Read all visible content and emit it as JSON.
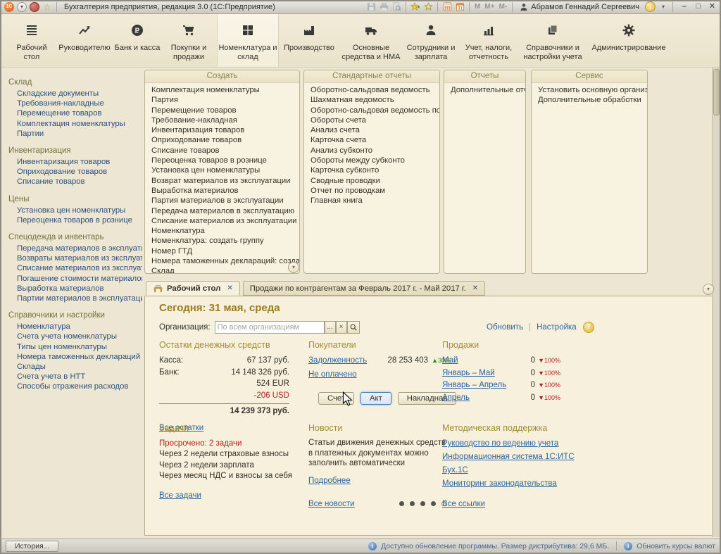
{
  "icons": {
    "chevron_down": "▾",
    "close": "✕",
    "clear": "×",
    "ellipsis": "...",
    "minimize": "–",
    "maximize": "□",
    "question": "?",
    "info": "i",
    "star": "☆",
    "logo": "1С"
  },
  "titlebar": {
    "title": "Бухгалтерия предприятия, редакция 3.0  (1С:Предприятие)",
    "user": "Абрамов Геннадий Сергеевич",
    "memory": [
      "M",
      "M+",
      "M-"
    ]
  },
  "ribbon": {
    "sections": [
      {
        "label": "Рабочий стол"
      },
      {
        "label": "Руководителю"
      },
      {
        "label": "Банк и касса"
      },
      {
        "label": "Покупки и продажи"
      },
      {
        "label": "Номенклатура и склад"
      },
      {
        "label": "Производство"
      },
      {
        "label": "Основные средства и НМА"
      },
      {
        "label": "Сотрудники и зарплата"
      },
      {
        "label": "Учет, налоги, отчетность"
      },
      {
        "label": "Справочники и настройки учета"
      },
      {
        "label": "Администрирование"
      }
    ]
  },
  "sidebar": {
    "groups": [
      {
        "title": "Склад",
        "items": [
          "Складские документы",
          "Требования-накладные",
          "Перемещение товаров",
          "Комплектация номенклатуры",
          "Партии"
        ]
      },
      {
        "title": "Инвентаризация",
        "items": [
          "Инвентаризация товаров",
          "Оприходование товаров",
          "Списание товаров"
        ]
      },
      {
        "title": "Цены",
        "items": [
          "Установка цен номенклатуры",
          "Переоценка товаров в рознице"
        ]
      },
      {
        "title": "Спецодежда и инвентарь",
        "items": [
          "Передача материалов в эксплуатацию",
          "Возвраты материалов из эксплуатации",
          "Списание материалов из эксплуатации",
          "Погашение стоимости материалов",
          "Выработка материалов",
          "Партии материалов в эксплуатации"
        ]
      },
      {
        "title": "Справочники и настройки",
        "items": [
          "Номенклатура",
          "Счета учета номенклатуры",
          "Типы цен номенклатуры",
          "Номера таможенных деклараций",
          "Склады",
          "Счета учета в НТТ",
          "Способы отражения расходов"
        ]
      }
    ]
  },
  "panels": {
    "create": {
      "title": "Создать",
      "items": [
        "Комплектация номенклатуры",
        "Партия",
        "Перемещение товаров",
        "Требование-накладная",
        "Инвентаризация товаров",
        "Оприходование товаров",
        "Списание товаров",
        "Переоценка товаров в рознице",
        "Установка цен номенклатуры",
        "Возврат материалов из эксплуатации",
        "Выработка материалов",
        "Партия материалов в эксплуатации",
        "Передача материалов в эксплуатацию",
        "Списание материалов из эксплуатации",
        "Номенклатура",
        "Номенклатура: создать группу",
        "Номер ГТД",
        "Номера таможенных деклараций: создать группу",
        "Склад"
      ]
    },
    "standard": {
      "title": "Стандартные отчеты",
      "items": [
        "Оборотно-сальдовая ведомость",
        "Шахматная ведомость",
        "Оборотно-сальдовая ведомость по счету",
        "Обороты счета",
        "Анализ счета",
        "Карточка счета",
        "Анализ субконто",
        "Обороты между субконто",
        "Карточка субконто",
        "Сводные проводки",
        "Отчет по проводкам",
        "Главная книга"
      ]
    },
    "reports": {
      "title": "Отчеты",
      "items": [
        "Дополнительные отчеты"
      ]
    },
    "service": {
      "title": "Сервис",
      "items": [
        "Установить основную организацию",
        "Дополнительные обработки"
      ]
    }
  },
  "tabs": {
    "desktop": "Рабочий стол",
    "sales": "Продажи по контрагентам за Февраль 2017 г. - Май 2017 г."
  },
  "desktop": {
    "today": "Сегодня: 31 мая, среда",
    "organization": {
      "label": "Организация:",
      "placeholder": "По всем организациям"
    },
    "refresh": "Обновить",
    "settings": "Настройка",
    "cash": {
      "title": "Остатки денежных средств",
      "rows": [
        {
          "label": "Касса:",
          "value": "67 137 руб."
        },
        {
          "label": "Банк:",
          "value": "14 148 326 руб."
        },
        {
          "label": "",
          "value": "524 EUR"
        },
        {
          "label": "",
          "value": "-206 USD",
          "negative": true
        }
      ],
      "total": "14 239 373 руб.",
      "link": "Все остатки"
    },
    "buyers": {
      "title": "Покупатели",
      "debt_link": "Задолженность",
      "debt_value": "28 253 403",
      "debt_change": "▲30%",
      "unpaid_link": "Не оплачено",
      "buttons": [
        "Счет",
        "Акт",
        "Накладная"
      ]
    },
    "sales": {
      "title": "Продажи",
      "rows": [
        {
          "label": "Май",
          "value": "0",
          "change": "▼100%"
        },
        {
          "label": "Январь – Май",
          "value": "0",
          "change": "▼100%"
        },
        {
          "label": "Январь – Апрель",
          "value": "0",
          "change": "▼100%"
        },
        {
          "label": "Апрель",
          "value": "0",
          "change": "▼100%"
        }
      ]
    },
    "tasks": {
      "title": "Задачи",
      "overdue": "Просрочено: 2 задачи",
      "items": [
        "Через 2 недели страховые взносы",
        "Через 2 недели зарплата",
        "Через месяц НДС и взносы за себя"
      ],
      "link": "Все задачи"
    },
    "news": {
      "title": "Новости",
      "text": "Статьи движения денежных средств в платежных документах можно заполнить автоматически",
      "more_link": "Подробнее",
      "all_link": "Все новости"
    },
    "support": {
      "title": "Методическая поддержка",
      "links": [
        "Руководство по ведению учета",
        "Информационная система 1С:ИТС",
        "Бух.1С",
        "Мониторинг законодательства"
      ],
      "all_link": "Все ссылки"
    }
  },
  "statusbar": {
    "history": "История...",
    "update_message": "Доступно обновление программы. Размер дистрибутива: 29,6 МБ.",
    "currency_link": "Обновить курсы валют"
  }
}
